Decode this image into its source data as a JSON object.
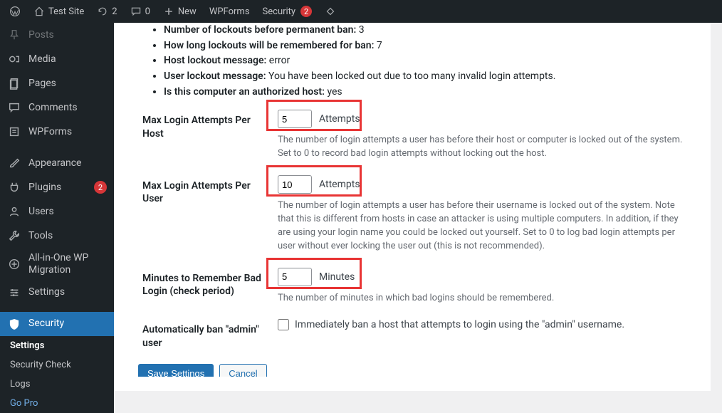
{
  "adminbar": {
    "site_name": "Test Site",
    "updates_count": "2",
    "comments_count": "0",
    "new_label": "New",
    "wpforms_label": "WPForms",
    "security_label": "Security",
    "security_count": "2"
  },
  "sidebar": {
    "items": [
      {
        "label": "Posts",
        "icon": "pin-icon"
      },
      {
        "label": "Media",
        "icon": "media-icon"
      },
      {
        "label": "Pages",
        "icon": "page-icon"
      },
      {
        "label": "Comments",
        "icon": "comment-icon"
      },
      {
        "label": "WPForms",
        "icon": "wpforms-icon"
      },
      {
        "label": "Appearance",
        "icon": "brush-icon"
      },
      {
        "label": "Plugins",
        "icon": "plug-icon",
        "badge": "2"
      },
      {
        "label": "Users",
        "icon": "user-icon"
      },
      {
        "label": "Tools",
        "icon": "wrench-icon"
      },
      {
        "label": "All-in-One WP Migration",
        "icon": "migration-icon"
      },
      {
        "label": "Settings",
        "icon": "sliders-icon"
      },
      {
        "label": "Security",
        "icon": "shield-icon",
        "active": true
      }
    ],
    "submenu": [
      {
        "label": "Settings",
        "current": true
      },
      {
        "label": "Security Check"
      },
      {
        "label": "Logs"
      },
      {
        "label": "Go Pro",
        "gopro": true
      }
    ]
  },
  "summary": [
    {
      "label": "Number of lockouts before permanent ban:",
      "value": "3"
    },
    {
      "label": "How long lockouts will be remembered for ban:",
      "value": "7"
    },
    {
      "label": "Host lockout message:",
      "value": "error"
    },
    {
      "label": "User lockout message:",
      "value": "You have been locked out due to too many invalid login attempts."
    },
    {
      "label": "Is this computer an authorized host:",
      "value": "yes"
    }
  ],
  "fields": {
    "max_host": {
      "label": "Max Login Attempts Per Host",
      "value": "5",
      "unit": "Attempts",
      "help": "The number of login attempts a user has before their host or computer is locked out of the system. Set to 0 to record bad login attempts without locking out the host."
    },
    "max_user": {
      "label": "Max Login Attempts Per User",
      "value": "10",
      "unit": "Attempts",
      "help": "The number of login attempts a user has before their username is locked out of the system. Note that this is different from hosts in case an attacker is using multiple computers. In addition, if they are using your login name you could be locked out yourself. Set to 0 to log bad login attempts per user without ever locking the user out (this is not recommended)."
    },
    "minutes": {
      "label": "Minutes to Remember Bad Login (check period)",
      "value": "5",
      "unit": "Minutes",
      "help": "The number of minutes in which bad logins should be remembered."
    },
    "auto_ban": {
      "label": "Automatically ban \"admin\" user",
      "checkbox_label": "Immediately ban a host that attempts to login using the \"admin\" username."
    }
  },
  "buttons": {
    "save": "Save Settings",
    "cancel": "Cancel"
  }
}
